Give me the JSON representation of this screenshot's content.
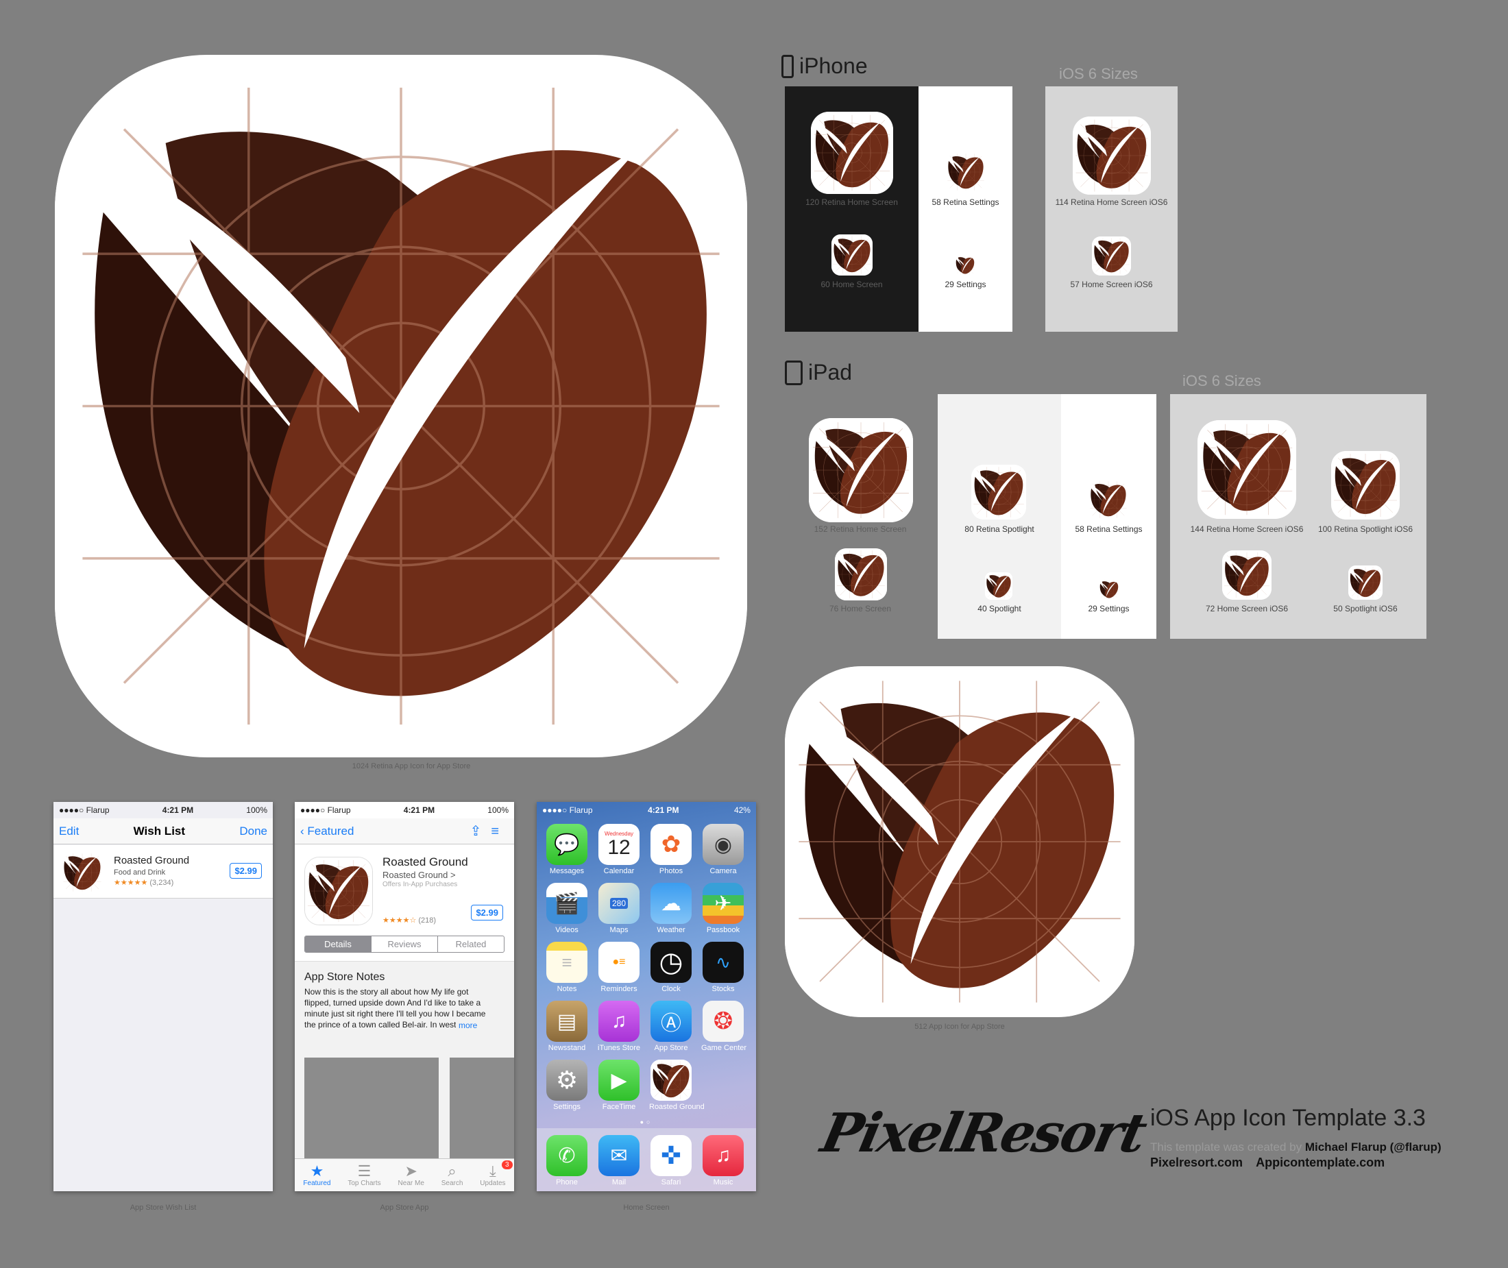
{
  "main_icon_caption": "1024 Retina App Icon for App Store",
  "small_icon_caption": "512 App Icon for App Store",
  "iphone": {
    "title": "iPhone",
    "ios6_title": "iOS 6 Sizes",
    "labels": {
      "retina_home": "120 Retina Home Screen",
      "retina_settings": "58 Retina Settings",
      "home": "60 Home Screen",
      "settings": "29 Settings",
      "ios6_retina_home": "114 Retina Home Screen iOS6",
      "ios6_home": "57 Home Screen iOS6"
    }
  },
  "ipad": {
    "title": "iPad",
    "ios6_title": "iOS 6 Sizes",
    "labels": {
      "retina_home": "152 Retina Home Screen",
      "home": "76 Home Screen",
      "retina_spotlight": "80 Retina Spotlight",
      "spotlight": "40 Spotlight",
      "retina_settings": "58 Retina Settings",
      "settings": "29 Settings",
      "ios6_retina_home": "144 Retina Home Screen iOS6",
      "ios6_retina_spotlight": "100 Retina Spotlight iOS6",
      "ios6_home": "72 Home Screen iOS6",
      "ios6_spotlight": "50 Spotlight iOS6"
    }
  },
  "status": {
    "carrier": "●●●●○ Flarup",
    "time": "4:21 PM",
    "battery": "100%",
    "battery_home": "42%"
  },
  "wishlist": {
    "caption": "App Store Wish List",
    "nav_left": "Edit",
    "nav_title": "Wish List",
    "nav_right": "Done",
    "app_name": "Roasted Ground",
    "category": "Food and Drink",
    "stars": "★★★★★",
    "rating_count": "(3,234)",
    "price": "$2.99"
  },
  "appstore": {
    "caption": "App Store App",
    "back": "Featured",
    "app_name": "Roasted Ground",
    "developer": "Roasted Ground >",
    "iap": "Offers In-App Purchases",
    "stars": "★★★★☆",
    "rating_count": "(218)",
    "price": "$2.99",
    "segments": [
      "Details",
      "Reviews",
      "Related"
    ],
    "notes_title": "App Store Notes",
    "notes_body": "Now this is the story all about how My life got flipped, turned upside down And I'd like to take a minute just sit right there I'll tell you how I became the prince of a town called Bel-air. In west Philadelphia born and raised On the ...",
    "more": "more",
    "tabs": [
      "Featured",
      "Top Charts",
      "Near Me",
      "Search",
      "Updates"
    ],
    "badge": "3"
  },
  "home": {
    "caption": "Home Screen",
    "calendar_day": "Wednesday",
    "calendar_date": "12",
    "maps_shield": "280",
    "apps": [
      "Messages",
      "Calendar",
      "Photos",
      "Camera",
      "Videos",
      "Maps",
      "Weather",
      "Passbook",
      "Notes",
      "Reminders",
      "Clock",
      "Stocks",
      "Newsstand",
      "iTunes Store",
      "App Store",
      "Game Center",
      "Settings",
      "FaceTime",
      "Roasted Ground"
    ],
    "dock": [
      "Phone",
      "Mail",
      "Safari",
      "Music"
    ]
  },
  "brand": {
    "logo": "PixelResort",
    "template_title": "iOS App Icon Template 3.3",
    "credit_prefix": "This template was created by",
    "credit_name": "Michael Flarup (@flarup)",
    "site1": "Pixelresort.com",
    "site2": "Appicontemplate.com"
  },
  "colors": {
    "bean_dark": "#2e1109",
    "bean_mid": "#3f1a0f",
    "bean_light": "#6f2d18",
    "background": "#808080"
  }
}
